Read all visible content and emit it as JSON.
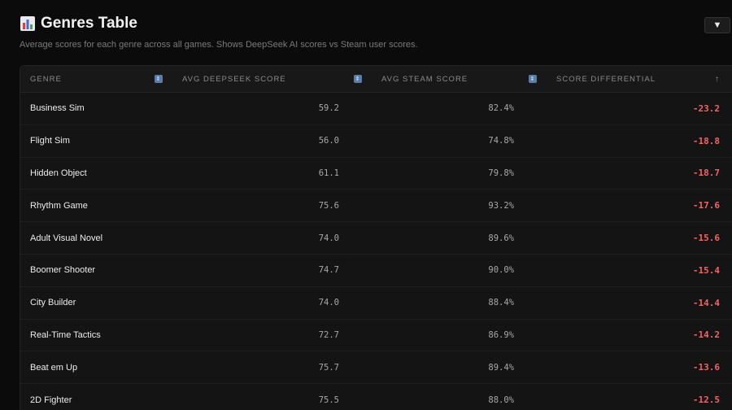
{
  "header": {
    "title": "Genres Table",
    "subtitle": "Average scores for each genre across all games. Shows DeepSeek AI scores vs Steam user scores.",
    "toggle_label": "▼"
  },
  "table": {
    "columns": [
      {
        "label": "Genre",
        "sort_icon": "sort-toggle-icon"
      },
      {
        "label": "Avg DeepSeek Score",
        "sort_icon": "sort-toggle-icon"
      },
      {
        "label": "Avg Steam Score",
        "sort_icon": "sort-toggle-icon"
      },
      {
        "label": "Score Differential",
        "sort_icon": "sort-ascending-arrow-icon",
        "sort_glyph": "↑"
      }
    ],
    "rows": [
      {
        "genre": "Business Sim",
        "deepseek": "59.2",
        "steam": "82.4%",
        "diff": "-23.2"
      },
      {
        "genre": "Flight Sim",
        "deepseek": "56.0",
        "steam": "74.8%",
        "diff": "-18.8"
      },
      {
        "genre": "Hidden Object",
        "deepseek": "61.1",
        "steam": "79.8%",
        "diff": "-18.7"
      },
      {
        "genre": "Rhythm Game",
        "deepseek": "75.6",
        "steam": "93.2%",
        "diff": "-17.6"
      },
      {
        "genre": "Adult Visual Novel",
        "deepseek": "74.0",
        "steam": "89.6%",
        "diff": "-15.6"
      },
      {
        "genre": "Boomer Shooter",
        "deepseek": "74.7",
        "steam": "90.0%",
        "diff": "-15.4"
      },
      {
        "genre": "City Builder",
        "deepseek": "74.0",
        "steam": "88.4%",
        "diff": "-14.4"
      },
      {
        "genre": "Real-Time Tactics",
        "deepseek": "72.7",
        "steam": "86.9%",
        "diff": "-14.2"
      },
      {
        "genre": "Beat em Up",
        "deepseek": "75.7",
        "steam": "89.4%",
        "diff": "-13.6"
      },
      {
        "genre": "2D Fighter",
        "deepseek": "75.5",
        "steam": "88.0%",
        "diff": "-12.5"
      }
    ]
  },
  "colors": {
    "background": "#0b0b0b",
    "negative": "#f26464",
    "sort_icon": "#5a7ea8"
  }
}
